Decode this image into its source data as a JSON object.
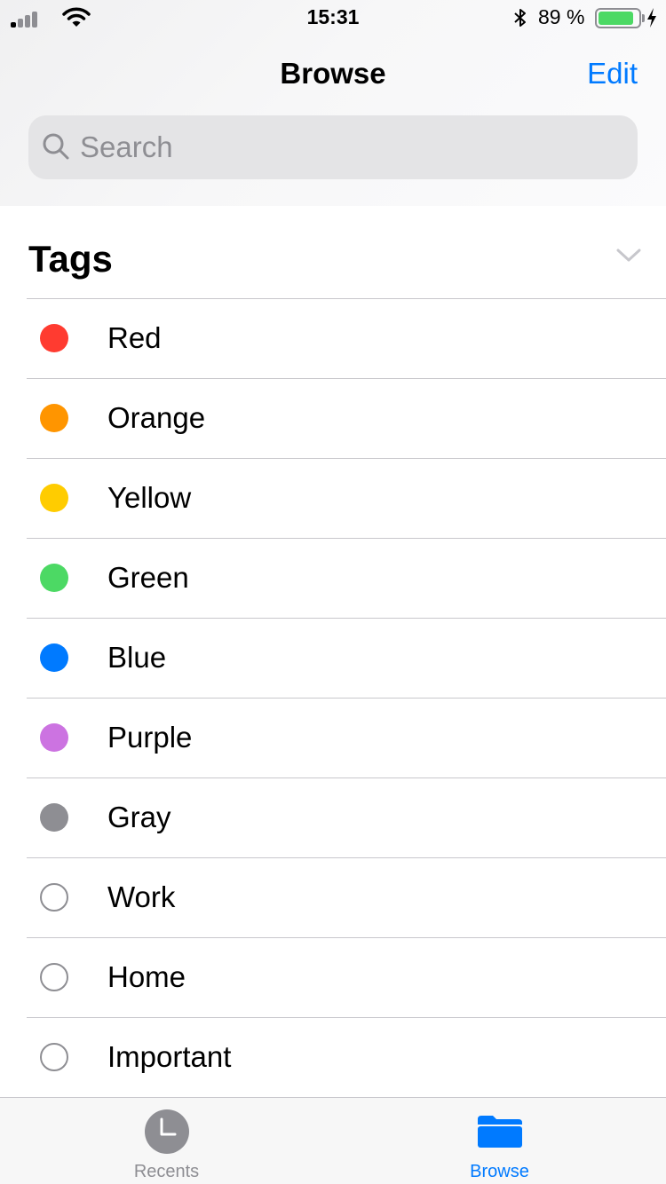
{
  "status_bar": {
    "time": "15:31",
    "battery_percent": "89 %",
    "battery_level": 0.89,
    "icons": [
      "signal-icon",
      "wifi-icon",
      "bluetooth-icon",
      "battery-icon",
      "charging-icon"
    ]
  },
  "nav": {
    "title": "Browse",
    "edit_label": "Edit"
  },
  "search": {
    "placeholder": "Search"
  },
  "tags_section": {
    "title": "Tags",
    "items": [
      {
        "label": "Red",
        "color": "#ff3b30",
        "filled": true
      },
      {
        "label": "Orange",
        "color": "#ff9500",
        "filled": true
      },
      {
        "label": "Yellow",
        "color": "#ffcc00",
        "filled": true
      },
      {
        "label": "Green",
        "color": "#4cd964",
        "filled": true
      },
      {
        "label": "Blue",
        "color": "#007aff",
        "filled": true
      },
      {
        "label": "Purple",
        "color": "#cc73e1",
        "filled": true
      },
      {
        "label": "Gray",
        "color": "#8e8e93",
        "filled": true
      },
      {
        "label": "Work",
        "color": "#8e8e93",
        "filled": false
      },
      {
        "label": "Home",
        "color": "#8e8e93",
        "filled": false
      },
      {
        "label": "Important",
        "color": "#8e8e93",
        "filled": false
      }
    ]
  },
  "tab_bar": {
    "recents_label": "Recents",
    "browse_label": "Browse",
    "active": "browse"
  },
  "colors": {
    "accent": "#007aff",
    "inactive": "#8e8e93"
  }
}
